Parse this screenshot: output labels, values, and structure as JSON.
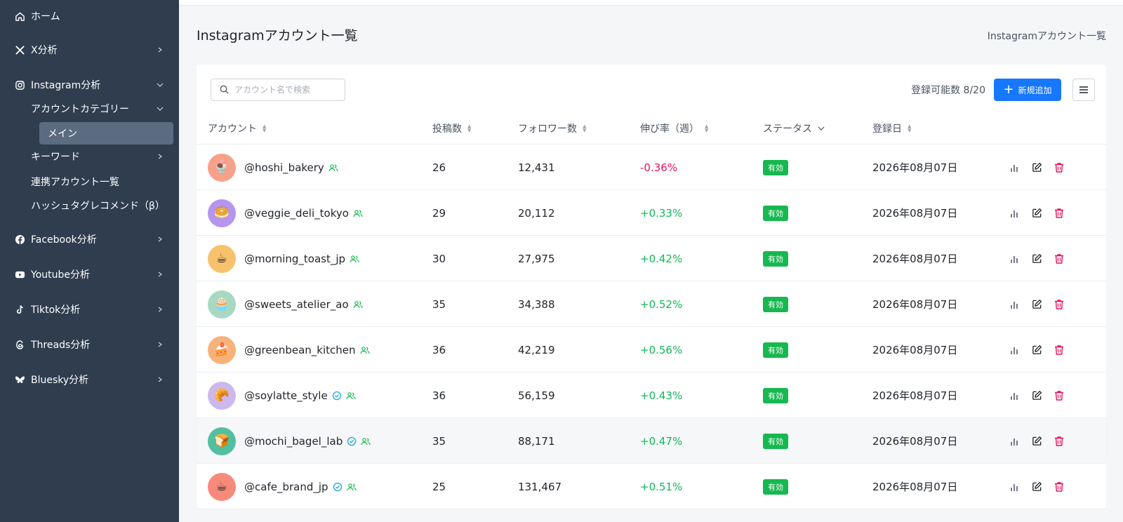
{
  "sidebar": {
    "items": [
      {
        "label": "ホーム",
        "icon": "home-icon"
      },
      {
        "label": "X分析",
        "icon": "x-logo-icon"
      },
      {
        "label": "Instagram分析",
        "icon": "instagram-icon"
      },
      {
        "label": "Facebook分析",
        "icon": "facebook-icon"
      },
      {
        "label": "Youtube分析",
        "icon": "youtube-icon"
      },
      {
        "label": "Tiktok分析",
        "icon": "tiktok-icon"
      },
      {
        "label": "Threads分析",
        "icon": "threads-icon"
      },
      {
        "label": "Bluesky分析",
        "icon": "bluesky-icon"
      }
    ],
    "instagram_sub": {
      "category": "アカウントカテゴリー",
      "main": "メイン",
      "keyword": "キーワード",
      "linked": "連携アカウント一覧",
      "hashtag": "ハッシュタグレコメンド（β）"
    }
  },
  "page": {
    "title": "Instagramアカウント一覧",
    "breadcrumb": "Instagramアカウント一覧"
  },
  "toolbar": {
    "search_placeholder": "アカウント名で検索",
    "quota": "登録可能数 8/20",
    "add_label": "新規追加"
  },
  "table": {
    "headers": [
      "アカウント",
      "投稿数",
      "フォロワー数",
      "伸び率（週）",
      "ステータス",
      "登録日"
    ],
    "rows": [
      {
        "handle": "@hoshi_bakery",
        "verified": false,
        "posts": "26",
        "followers": "12,431",
        "growth": "-0.36%",
        "status": "有効",
        "date": "2026年08月07日",
        "avatar": "🍨",
        "avatar_bg": "#f7a18a"
      },
      {
        "handle": "@veggie_deli_tokyo",
        "verified": false,
        "posts": "29",
        "followers": "20,112",
        "growth": "+0.33%",
        "status": "有効",
        "date": "2026年08月07日",
        "avatar": "🥯",
        "avatar_bg": "#b595f0"
      },
      {
        "handle": "@morning_toast_jp",
        "verified": false,
        "posts": "30",
        "followers": "27,975",
        "growth": "+0.42%",
        "status": "有効",
        "date": "2026年08月07日",
        "avatar": "☕",
        "avatar_bg": "#f7c26b"
      },
      {
        "handle": "@sweets_atelier_ao",
        "verified": false,
        "posts": "35",
        "followers": "34,388",
        "growth": "+0.52%",
        "status": "有効",
        "date": "2026年08月07日",
        "avatar": "🧁",
        "avatar_bg": "#a8d8c2"
      },
      {
        "handle": "@greenbean_kitchen",
        "verified": false,
        "posts": "36",
        "followers": "42,219",
        "growth": "+0.56%",
        "status": "有効",
        "date": "2026年08月07日",
        "avatar": "🍰",
        "avatar_bg": "#f7b27a"
      },
      {
        "handle": "@soylatte_style",
        "verified": true,
        "posts": "36",
        "followers": "56,159",
        "growth": "+0.43%",
        "status": "有効",
        "date": "2026年08月07日",
        "avatar": "🥐",
        "avatar_bg": "#cdb8ee"
      },
      {
        "handle": "@mochi_bagel_lab",
        "verified": true,
        "posts": "35",
        "followers": "88,171",
        "growth": "+0.47%",
        "status": "有効",
        "date": "2026年08月07日",
        "avatar": "🍞",
        "avatar_bg": "#52c0a0"
      },
      {
        "handle": "@cafe_brand_jp",
        "verified": true,
        "posts": "25",
        "followers": "131,467",
        "growth": "+0.51%",
        "status": "有効",
        "date": "2026年08月07日",
        "avatar": "☕",
        "avatar_bg": "#f78a7a"
      }
    ]
  },
  "colors": {
    "sidebar_bg": "#2f3d4f",
    "accent": "#1677ff",
    "status_green": "#16b84f",
    "negative": "#e5135b",
    "positive": "#10b957",
    "delete_red": "#e5135b"
  }
}
